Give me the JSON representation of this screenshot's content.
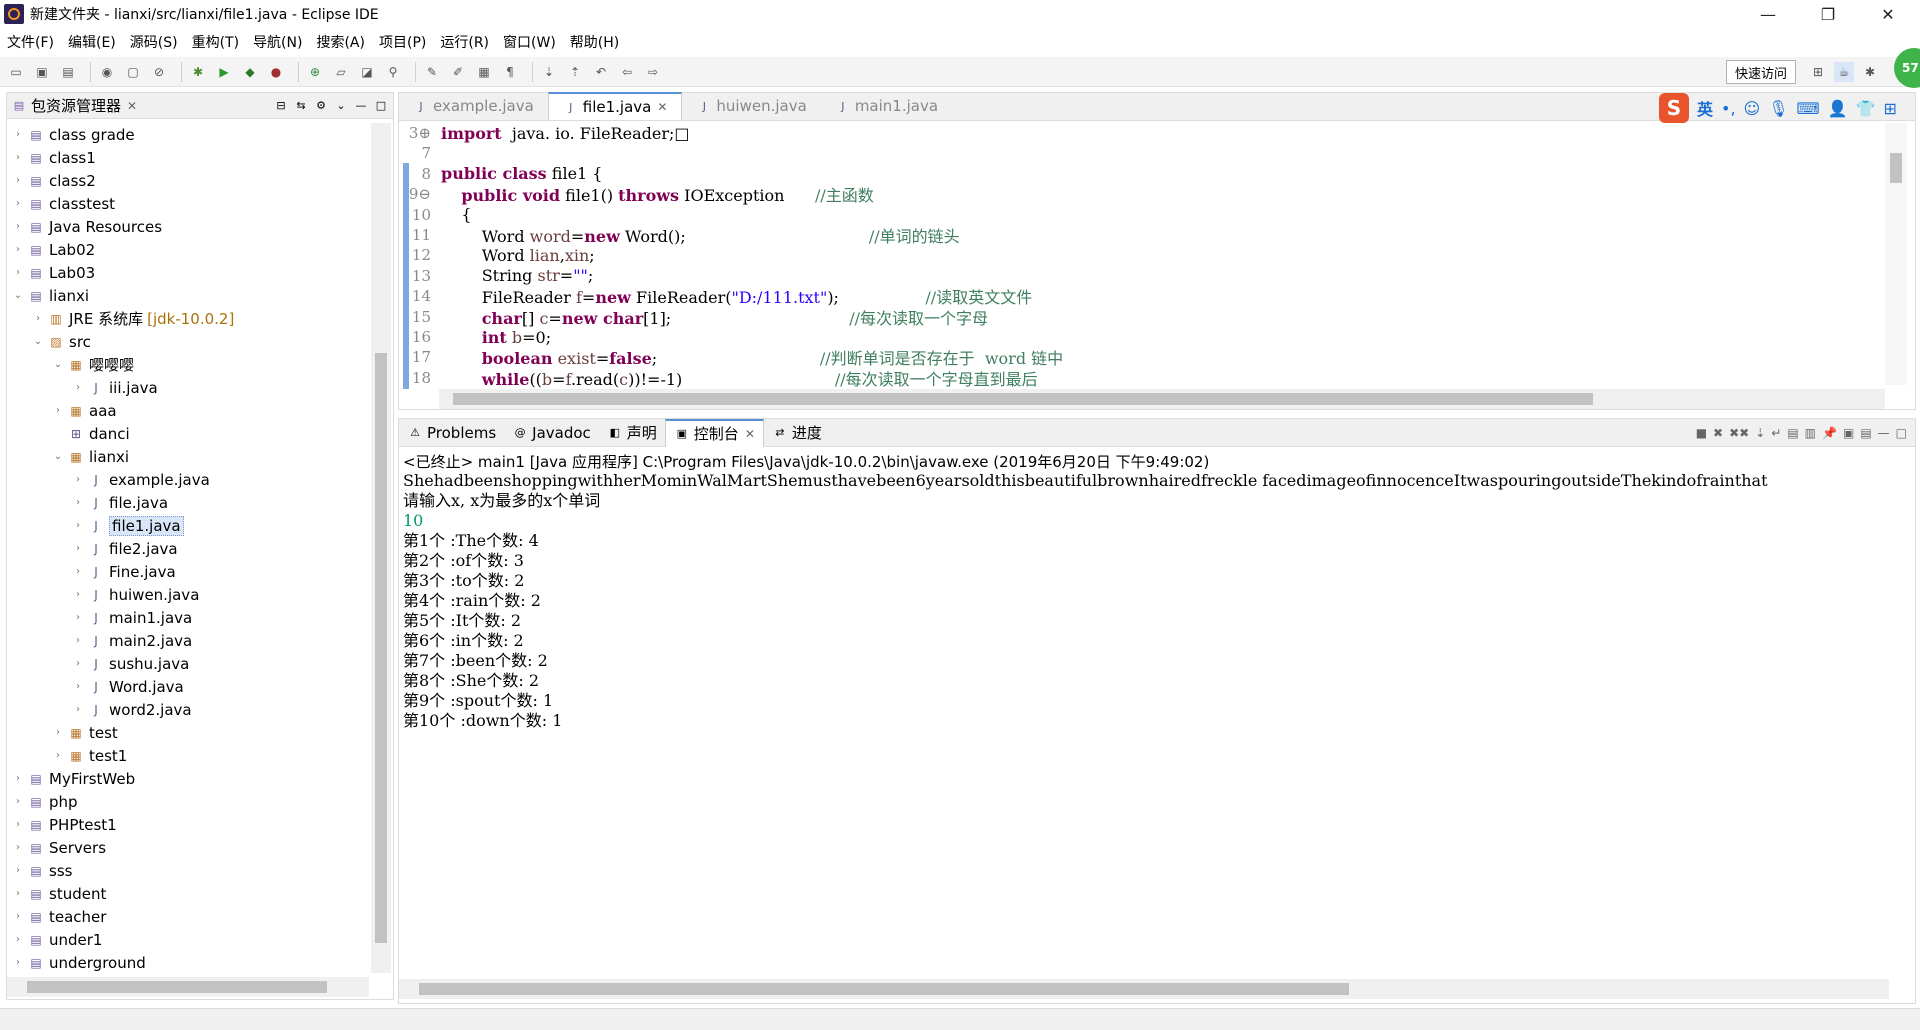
{
  "window": {
    "title": "新建文件夹 - lianxi/src/lianxi/file1.java - Eclipse IDE",
    "minimize": "—",
    "restore": "❐",
    "close": "✕"
  },
  "menu": [
    "文件(F)",
    "编辑(E)",
    "源码(S)",
    "重构(T)",
    "导航(N)",
    "搜索(A)",
    "项目(P)",
    "运行(R)",
    "窗口(W)",
    "帮助(H)"
  ],
  "toolbar": {
    "quick_access": "快速访问",
    "badge": "57"
  },
  "package_explorer": {
    "title": "包资源管理器",
    "close": "✕",
    "items": [
      {
        "label": "class grade",
        "kind": "project",
        "arrow": "›",
        "indent": 0
      },
      {
        "label": "class1",
        "kind": "project",
        "arrow": "›",
        "indent": 0
      },
      {
        "label": "class2",
        "kind": "project",
        "arrow": "›",
        "indent": 0
      },
      {
        "label": "classtest",
        "kind": "project",
        "arrow": "›",
        "indent": 0
      },
      {
        "label": "Java Resources",
        "kind": "project",
        "arrow": "›",
        "indent": 0
      },
      {
        "label": "Lab02",
        "kind": "project",
        "arrow": "›",
        "indent": 0
      },
      {
        "label": "Lab03",
        "kind": "project",
        "arrow": "›",
        "indent": 0
      },
      {
        "label": "lianxi",
        "kind": "project",
        "arrow": "⌄",
        "indent": 0
      },
      {
        "label": "JRE 系统库",
        "extra": "[jdk-10.0.2]",
        "kind": "library",
        "arrow": "›",
        "indent": 1
      },
      {
        "label": "src",
        "kind": "folder",
        "arrow": "⌄",
        "indent": 1
      },
      {
        "label": "嘤嘤嘤",
        "kind": "package",
        "arrow": "⌄",
        "indent": 2
      },
      {
        "label": "iii.java",
        "kind": "java",
        "arrow": "›",
        "indent": 3
      },
      {
        "label": "aaa",
        "kind": "package",
        "arrow": "›",
        "indent": 2
      },
      {
        "label": "danci",
        "kind": "package-empty",
        "arrow": "",
        "indent": 2
      },
      {
        "label": "lianxi",
        "kind": "package",
        "arrow": "⌄",
        "indent": 2
      },
      {
        "label": "example.java",
        "kind": "java",
        "arrow": "›",
        "indent": 3
      },
      {
        "label": "file.java",
        "kind": "java",
        "arrow": "›",
        "indent": 3
      },
      {
        "label": "file1.java",
        "kind": "java",
        "arrow": "›",
        "indent": 3,
        "selected": true
      },
      {
        "label": "file2.java",
        "kind": "java",
        "arrow": "›",
        "indent": 3
      },
      {
        "label": "Fine.java",
        "kind": "java",
        "arrow": "›",
        "indent": 3
      },
      {
        "label": "huiwen.java",
        "kind": "java",
        "arrow": "›",
        "indent": 3
      },
      {
        "label": "main1.java",
        "kind": "java",
        "arrow": "›",
        "indent": 3
      },
      {
        "label": "main2.java",
        "kind": "java",
        "arrow": "›",
        "indent": 3
      },
      {
        "label": "sushu.java",
        "kind": "java",
        "arrow": "›",
        "indent": 3
      },
      {
        "label": "Word.java",
        "kind": "java",
        "arrow": "›",
        "indent": 3
      },
      {
        "label": "word2.java",
        "kind": "java",
        "arrow": "›",
        "indent": 3
      },
      {
        "label": "test",
        "kind": "package",
        "arrow": "›",
        "indent": 2
      },
      {
        "label": "test1",
        "kind": "package",
        "arrow": "›",
        "indent": 2
      },
      {
        "label": "MyFirstWeb",
        "kind": "project",
        "arrow": "›",
        "indent": 0
      },
      {
        "label": "php",
        "kind": "project",
        "arrow": "›",
        "indent": 0
      },
      {
        "label": "PHPtest1",
        "kind": "project",
        "arrow": "›",
        "indent": 0
      },
      {
        "label": "Servers",
        "kind": "project",
        "arrow": "›",
        "indent": 0
      },
      {
        "label": "sss",
        "kind": "project",
        "arrow": "›",
        "indent": 0
      },
      {
        "label": "student",
        "kind": "project",
        "arrow": "›",
        "indent": 0
      },
      {
        "label": "teacher",
        "kind": "project",
        "arrow": "›",
        "indent": 0
      },
      {
        "label": "under1",
        "kind": "project",
        "arrow": "›",
        "indent": 0
      },
      {
        "label": "underground",
        "kind": "project",
        "arrow": "›",
        "indent": 0
      }
    ]
  },
  "editor": {
    "tabs": [
      {
        "label": "example.java",
        "active": false
      },
      {
        "label": "file1.java",
        "active": true
      },
      {
        "label": "huiwen.java",
        "active": false
      },
      {
        "label": "main1.java",
        "active": false
      }
    ],
    "ime": {
      "logo": "S",
      "lang": "英"
    },
    "lines": [
      {
        "n": "3⊕",
        "segs": [
          [
            "kw",
            "import"
          ],
          [
            "",
            "  java. io. FileReader;"
          ],
          [
            "",
            "□"
          ]
        ]
      },
      {
        "n": "7",
        "segs": []
      },
      {
        "n": "8",
        "segs": [
          [
            "kw",
            "public class"
          ],
          [
            "",
            " file1 {"
          ]
        ]
      },
      {
        "n": "9⊖",
        "segs": [
          [
            "",
            "    "
          ],
          [
            "kw",
            "public void"
          ],
          [
            "",
            " file1() "
          ],
          [
            "kw",
            "throws"
          ],
          [
            "",
            " IOException      "
          ],
          [
            "cm",
            "//主函数"
          ]
        ]
      },
      {
        "n": "10",
        "segs": [
          [
            "",
            "    {"
          ]
        ]
      },
      {
        "n": "11",
        "segs": [
          [
            "",
            "        Word "
          ],
          [
            "lv",
            "word"
          ],
          [
            "",
            "="
          ],
          [
            "kw",
            "new"
          ],
          [
            "",
            " Word();                                    "
          ],
          [
            "cm",
            "//单词的链头"
          ]
        ]
      },
      {
        "n": "12",
        "segs": [
          [
            "",
            "        Word "
          ],
          [
            "lv",
            "lian"
          ],
          [
            "",
            ","
          ],
          [
            "lv",
            "xin"
          ],
          [
            "",
            ";"
          ]
        ]
      },
      {
        "n": "13",
        "segs": [
          [
            "",
            "        String "
          ],
          [
            "lv",
            "str"
          ],
          [
            "",
            "="
          ],
          [
            "st",
            "\"\""
          ],
          [
            "",
            ";"
          ]
        ]
      },
      {
        "n": "14",
        "segs": [
          [
            "",
            "        FileReader "
          ],
          [
            "lv",
            "f"
          ],
          [
            "",
            "="
          ],
          [
            "kw",
            "new"
          ],
          [
            "",
            " FileReader("
          ],
          [
            "st",
            "\"D:/111.txt\""
          ],
          [
            "",
            ");                 "
          ],
          [
            "cm",
            "//读取英文文件"
          ]
        ]
      },
      {
        "n": "15",
        "segs": [
          [
            "",
            "        "
          ],
          [
            "kw",
            "char"
          ],
          [
            "",
            "[] "
          ],
          [
            "lv",
            "c"
          ],
          [
            "",
            "="
          ],
          [
            "kw",
            "new char"
          ],
          [
            "",
            "[1];                                   "
          ],
          [
            "cm",
            "//每次读取一个字母"
          ]
        ]
      },
      {
        "n": "16",
        "segs": [
          [
            "",
            "        "
          ],
          [
            "kw",
            "int"
          ],
          [
            "",
            " "
          ],
          [
            "lv",
            "b"
          ],
          [
            "",
            "=0;"
          ]
        ]
      },
      {
        "n": "17",
        "segs": [
          [
            "",
            "        "
          ],
          [
            "kw",
            "boolean"
          ],
          [
            "",
            " "
          ],
          [
            "lv",
            "exist"
          ],
          [
            "",
            "="
          ],
          [
            "kw",
            "false"
          ],
          [
            "",
            ";                                "
          ],
          [
            "cm",
            "//判断单词是否存在于  word 链中"
          ]
        ]
      },
      {
        "n": "18",
        "segs": [
          [
            "",
            "        "
          ],
          [
            "kw",
            "while"
          ],
          [
            "",
            "(("
          ],
          [
            "lv",
            "b"
          ],
          [
            "",
            "="
          ],
          [
            "lv",
            "f"
          ],
          [
            "",
            ".read("
          ],
          [
            "lv",
            "c"
          ],
          [
            "",
            "))!=-1)                              "
          ],
          [
            "cm",
            "//每次读取一个字母直到最后"
          ]
        ]
      }
    ]
  },
  "console": {
    "tabs": [
      {
        "label": "Problems",
        "icon": "⚠",
        "active": false
      },
      {
        "label": "Javadoc",
        "icon": "@",
        "active": false
      },
      {
        "label": "声明",
        "icon": "◧",
        "active": false
      },
      {
        "label": "控制台",
        "icon": "▣",
        "active": true
      },
      {
        "label": "进度",
        "icon": "⇄",
        "active": false
      }
    ],
    "status": "<已终止> main1 [Java 应用程序] C:\\Program Files\\Java\\jdk-10.0.2\\bin\\javaw.exe  (2019年6月20日 下午9:49:02)",
    "output": [
      {
        "text": "ShehadbeenshoppingwithherMominWalMartShemusthavebeen6yearsoldthisbeautifulbrownhairedfreckle facedimageofinnocenceItwaspouringoutsideThekindofrainthat",
        "input": false
      },
      {
        "text": "请输入x, x为最多的x个单词",
        "input": false
      },
      {
        "text": "10",
        "input": true
      },
      {
        "text": "第1个 :The个数: 4",
        "input": false
      },
      {
        "text": "第2个 :of个数: 3",
        "input": false
      },
      {
        "text": "第3个 :to个数: 2",
        "input": false
      },
      {
        "text": "第4个 :rain个数: 2",
        "input": false
      },
      {
        "text": "第5个 :It个数: 2",
        "input": false
      },
      {
        "text": "第6个 :in个数: 2",
        "input": false
      },
      {
        "text": "第7个 :been个数: 2",
        "input": false
      },
      {
        "text": "第8个 :She个数: 2",
        "input": false
      },
      {
        "text": "第9个 :spout个数: 1",
        "input": false
      },
      {
        "text": "第10个 :down个数: 1",
        "input": false
      }
    ]
  }
}
